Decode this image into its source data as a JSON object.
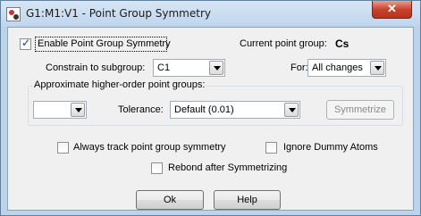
{
  "window": {
    "title": "G1:M1:V1 - Point Group Symmetry",
    "close_label": "✕"
  },
  "options": {
    "enable_label": "Enable Point Group Symmetry",
    "enable_checked": true,
    "current_group_label": "Current point group:",
    "current_group_value": "Cs",
    "constrain_label": "Constrain to subgroup:",
    "constrain_value": "C1",
    "for_label": "For:",
    "for_value": "All changes"
  },
  "higher_order": {
    "group_label": "Approximate higher-order point groups:",
    "group_select_value": "",
    "tolerance_label": "Tolerance:",
    "tolerance_value": "Default (0.01)",
    "symmetrize_label": "Symmetrize"
  },
  "checkboxes": {
    "always_track_label": "Always track point group symmetry",
    "always_track_checked": false,
    "ignore_dummy_label": "Ignore Dummy Atoms",
    "ignore_dummy_checked": false,
    "rebond_label": "Rebond after Symmetrizing",
    "rebond_checked": false
  },
  "buttons": {
    "ok_label": "Ok",
    "help_label": "Help"
  }
}
